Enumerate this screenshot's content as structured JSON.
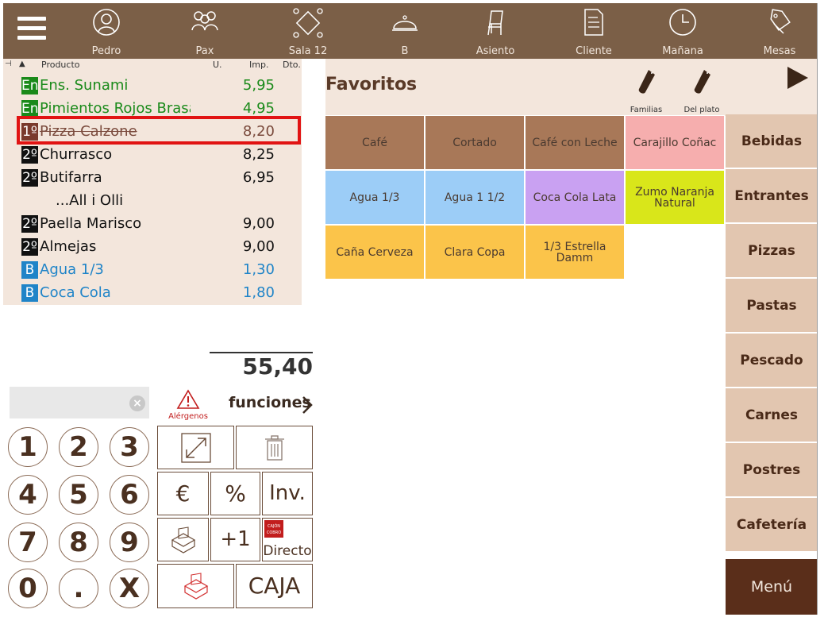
{
  "topbar": {
    "items": [
      {
        "label": "Pedro",
        "icon": "user-circle-icon"
      },
      {
        "label": "Pax",
        "icon": "people-group-icon"
      },
      {
        "label": "Sala 12",
        "icon": "room-table-icon"
      },
      {
        "label": "B",
        "icon": "cloche-icon"
      },
      {
        "label": "Asiento",
        "icon": "chair-icon"
      },
      {
        "label": "Cliente",
        "icon": "client-document-icon"
      },
      {
        "label": "Mañana",
        "icon": "clock-icon"
      },
      {
        "label": "Mesas",
        "icon": "tags-icon"
      }
    ]
  },
  "order": {
    "headers": {
      "producto": "Producto",
      "units": "U.",
      "importe": "Imp.",
      "dto": "Dto."
    },
    "rows": [
      {
        "badge": "En",
        "name": "Ens. Sunami",
        "price": "5,95",
        "style": "green",
        "badge_color": "#1a8a1a"
      },
      {
        "badge": "En",
        "name": "Pimientos Rojos Brasa",
        "price": "4,95",
        "style": "green",
        "badge_color": "#1a8a1a"
      },
      {
        "badge": "1º",
        "name": "Pizza Calzone",
        "price": "8,20",
        "style": "strike",
        "badge_color": "#7a3a2c"
      },
      {
        "badge": "2º",
        "name": "Churrasco",
        "price": "8,25",
        "style": "black",
        "badge_color": "#111111"
      },
      {
        "badge": "2º",
        "name": "Butifarra",
        "price": "6,95",
        "style": "black",
        "badge_color": "#111111"
      },
      {
        "badge": "",
        "name": "...All i Olli",
        "price": "",
        "style": "black",
        "badge_color": ""
      },
      {
        "badge": "2º",
        "name": "Paella Marisco",
        "price": "9,00",
        "style": "black",
        "badge_color": "#111111"
      },
      {
        "badge": "2º",
        "name": "Almejas",
        "price": "9,00",
        "style": "black",
        "badge_color": "#111111"
      },
      {
        "badge": "B",
        "name": "Agua 1/3",
        "price": "1,30",
        "style": "blue",
        "badge_color": "#1f84c8"
      },
      {
        "badge": "B",
        "name": "Coca Cola",
        "price": "1,80",
        "style": "blue",
        "badge_color": "#1f84c8"
      }
    ],
    "total": "55,40"
  },
  "controls": {
    "alergenos": "Alérgenos",
    "funciones": "funciones",
    "keys": [
      "1",
      "2",
      "3",
      "4",
      "5",
      "6",
      "7",
      "8",
      "9",
      "0",
      ".",
      "X"
    ],
    "euro": "€",
    "percent": "%",
    "inv": "Inv.",
    "plus_one": "+1",
    "directo": "Directo",
    "caja": "CAJA",
    "directo_badge_text": "CAJÓN COBRO"
  },
  "favoritos": {
    "title": "Favoritos",
    "familias": "Familias",
    "del_plato": "Del plato",
    "products": [
      {
        "label": "Café",
        "color": "#a87858"
      },
      {
        "label": "Cortado",
        "color": "#a87858"
      },
      {
        "label": "Café con Leche",
        "color": "#a87858"
      },
      {
        "label": "Carajillo Coñac",
        "color": "#f6aeae"
      },
      {
        "label": "Agua 1/3",
        "color": "#9ccdf7"
      },
      {
        "label": "Agua 1 1/2",
        "color": "#9ccdf7"
      },
      {
        "label": "Coca Cola Lata",
        "color": "#c9a1f2"
      },
      {
        "label": "Zumo Naranja Natural",
        "color": "#d9e61a"
      },
      {
        "label": "Caña Cerveza",
        "color": "#fbc44a"
      },
      {
        "label": "Clara Copa",
        "color": "#fbc44a"
      },
      {
        "label": "1/3 Estrella Damm",
        "color": "#fbc44a"
      }
    ]
  },
  "categories": [
    "Bebidas",
    "Entrantes",
    "Pizzas",
    "Pastas",
    "Pescado",
    "Carnes",
    "Postres",
    "Cafetería"
  ],
  "menu_label": "Menú"
}
